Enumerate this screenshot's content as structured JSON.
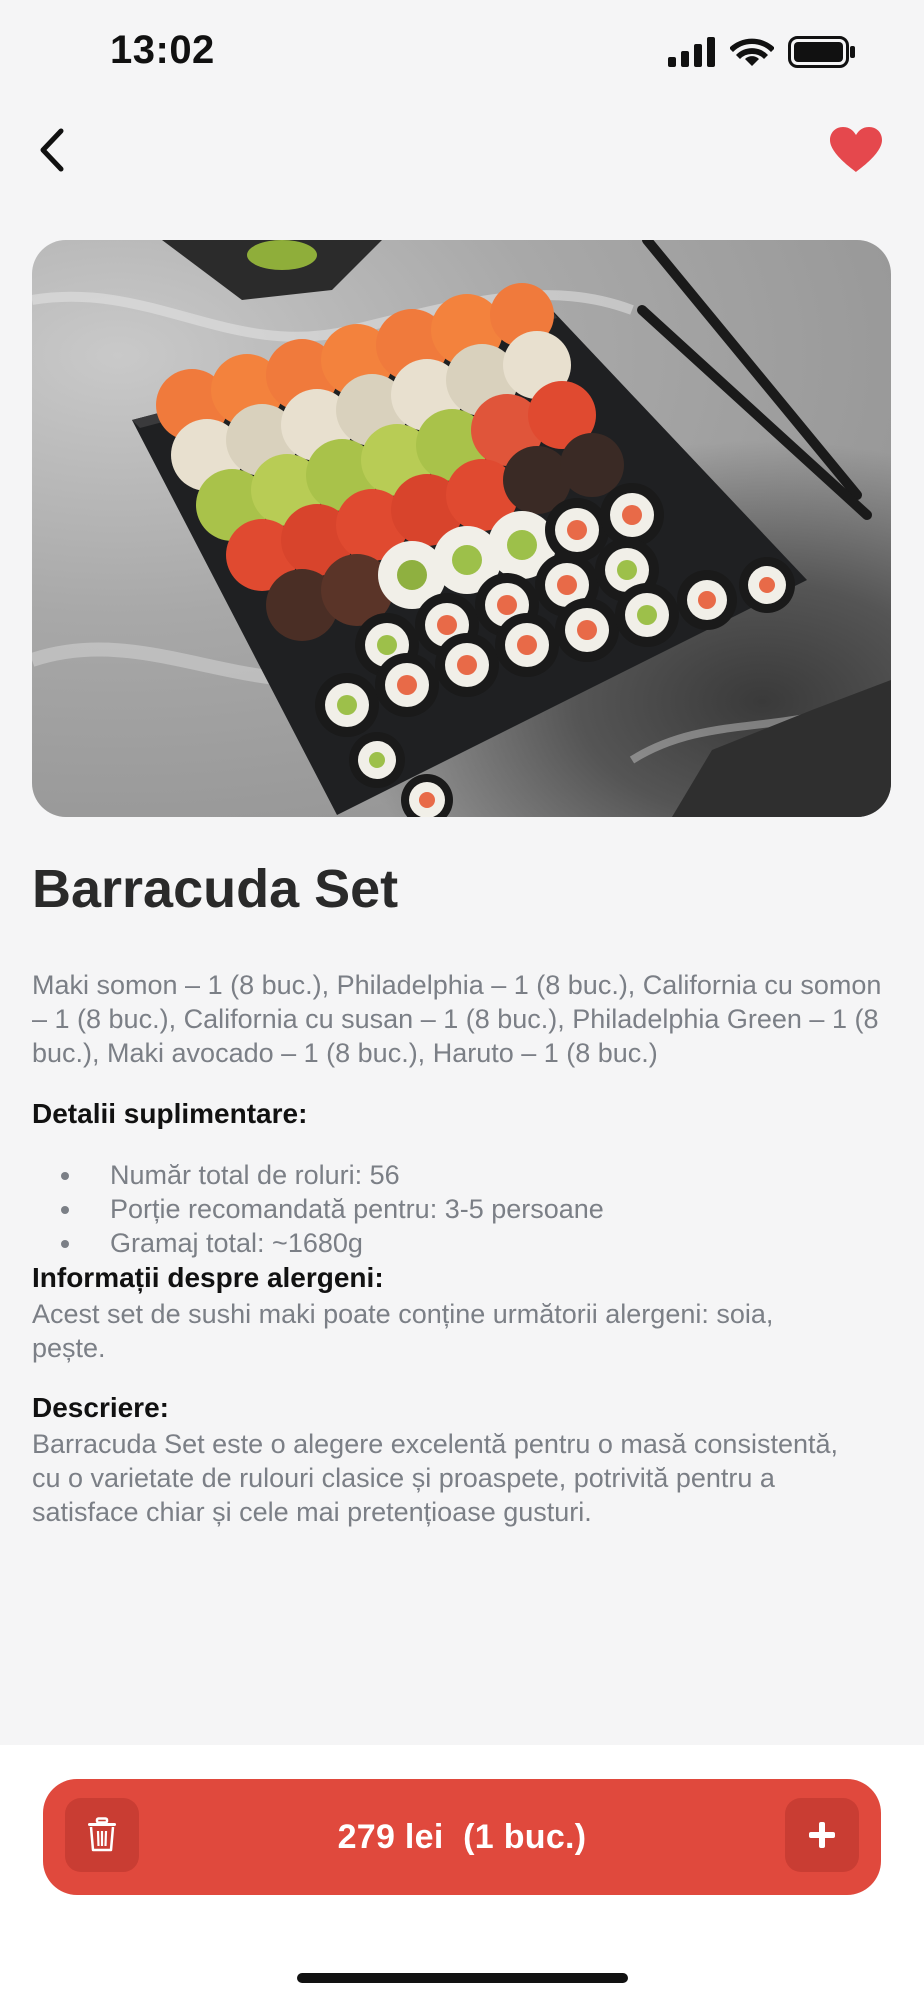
{
  "status_bar": {
    "time": "13:02"
  },
  "nav": {
    "back_icon": "chevron-left-icon",
    "favorite_icon": "heart-icon",
    "favorite_color": "#e5484d"
  },
  "product": {
    "title": "Barracuda Set",
    "ingredients": "Maki somon – 1 (8 buc.), Philadelphia – 1 (8 buc.), California cu somon – 1 (8 buc.), California cu susan – 1 (8 buc.), Philadelphia Green – 1 (8 buc.), Maki avocado – 1 (8 buc.), Haruto – 1 (8 buc.)",
    "details_heading": "Detalii suplimentare:",
    "details": [
      "Număr total de roluri: 56",
      "Porție recomandată pentru: 3-5 persoane",
      "Gramaj total: ~1680g"
    ],
    "allergens_heading": "Informații despre alergeni:",
    "allergens_text": "Acest set de sushi maki poate conține următorii alergeni: soia, pește.",
    "description_heading": "Descriere:",
    "description_text": "Barracuda Set este o alegere excelentă pentru o masă consistentă, cu o varietate de rulouri clasice și proaspete, potrivită pentru a satisface chiar și cele mai pretențioase gusturi."
  },
  "cart": {
    "price_label": "279 lei  (1 buc.)",
    "trash_icon": "trash-icon",
    "plus_icon": "plus-icon",
    "accent_color": "#e0493d"
  }
}
